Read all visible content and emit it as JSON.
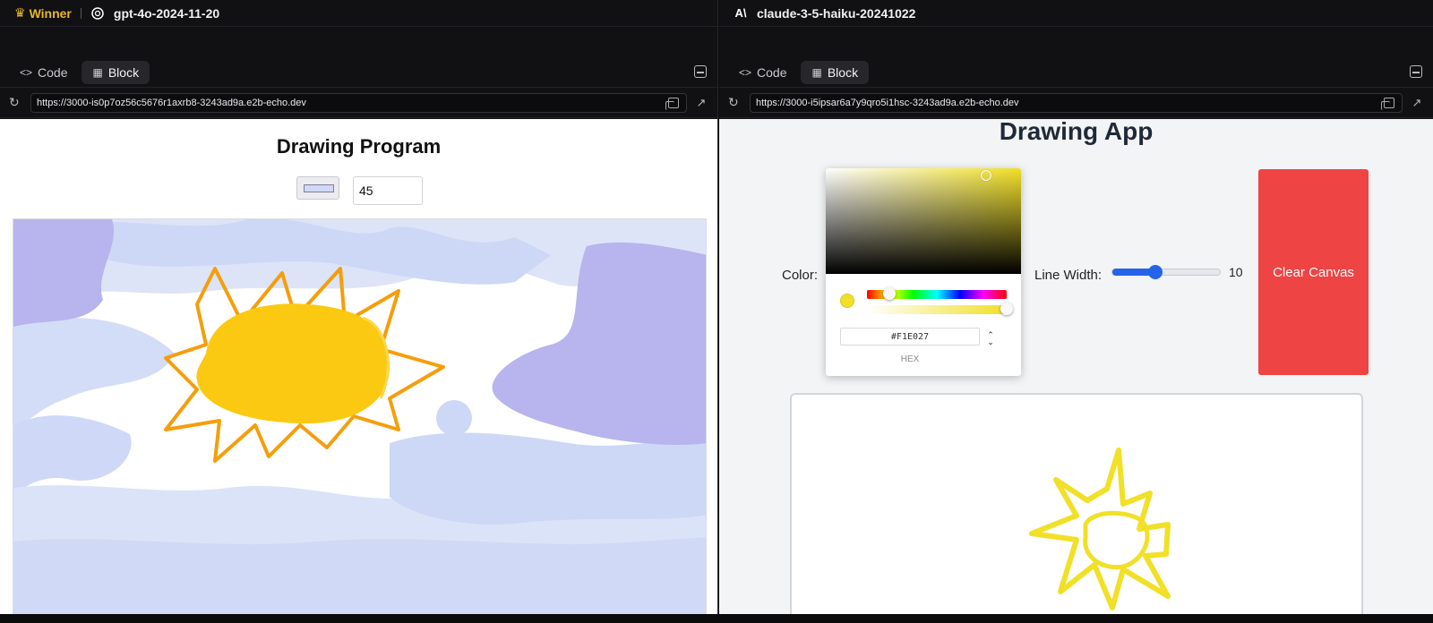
{
  "left": {
    "winner_label": "Winner",
    "model": "gpt-4o-2024-11-20",
    "tabs": [
      {
        "label": "Code"
      },
      {
        "label": "Block"
      }
    ],
    "url": "https://3000-is0p7oz56c5676r1axrb8-3243ad9a.e2b-echo.dev",
    "app": {
      "title": "Drawing Program",
      "line_width": "45",
      "color_value": "#cfd9f7"
    }
  },
  "right": {
    "model": "claude-3-5-haiku-20241022",
    "tabs": [
      {
        "label": "Code"
      },
      {
        "label": "Block"
      }
    ],
    "url": "https://3000-i5ipsar6a7y9qro5i1hsc-3243ad9a.e2b-echo.dev",
    "app": {
      "title": "Drawing App",
      "color_label": "Color:",
      "hex_value": "#F1E027",
      "hex_label": "HEX",
      "line_width_label": "Line Width:",
      "line_width_value": "10",
      "line_width_fraction": 0.4,
      "clear_label": "Clear Canvas"
    }
  },
  "colors": {
    "winner": "#e8b62a",
    "brush_yellow": "#f1e027",
    "clear_button": "#ef4444",
    "slider": "#2563eb"
  }
}
